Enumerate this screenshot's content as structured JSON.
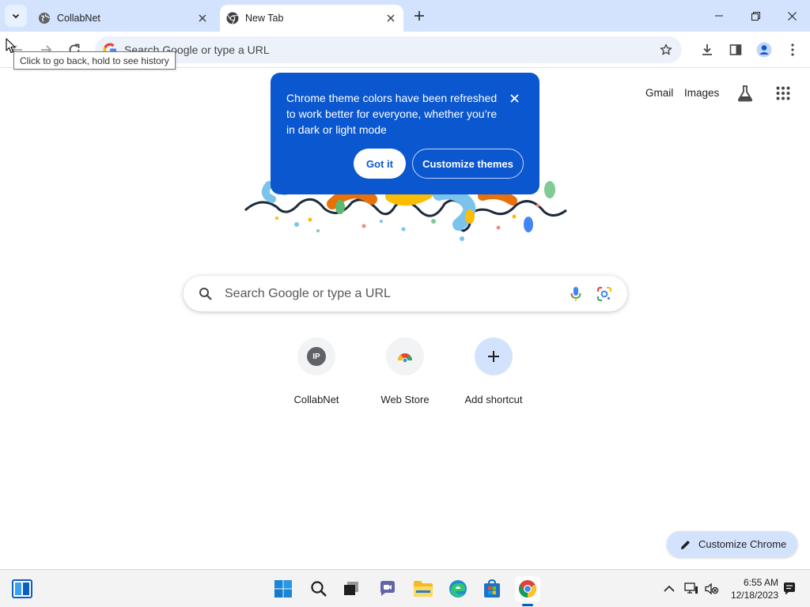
{
  "tabs": [
    {
      "title": "CollabNet",
      "active": false
    },
    {
      "title": "New Tab",
      "active": true
    }
  ],
  "toolbar": {
    "omnibox_placeholder": "Search Google or type a URL",
    "back_tooltip": "Click to go back, hold to see history"
  },
  "ntp": {
    "links": {
      "gmail": "Gmail",
      "images": "Images"
    },
    "promo": {
      "text": "Chrome theme colors have been refreshed to work better for everyone, whether you’re in dark or light mode",
      "got_it": "Got it",
      "customize_themes": "Customize themes"
    },
    "search_placeholder": "Search Google or type a URL",
    "shortcuts": [
      {
        "label": "CollabNet",
        "initials": "IP"
      },
      {
        "label": "Web Store"
      },
      {
        "label": "Add shortcut"
      }
    ],
    "customize_chrome": "Customize Chrome"
  },
  "taskbar": {
    "time": "6:55 AM",
    "date": "12/18/2023"
  },
  "colors": {
    "tabstrip": "#d3e3fd",
    "promo": "#0b57d0",
    "omnibox": "#edf2fa"
  }
}
